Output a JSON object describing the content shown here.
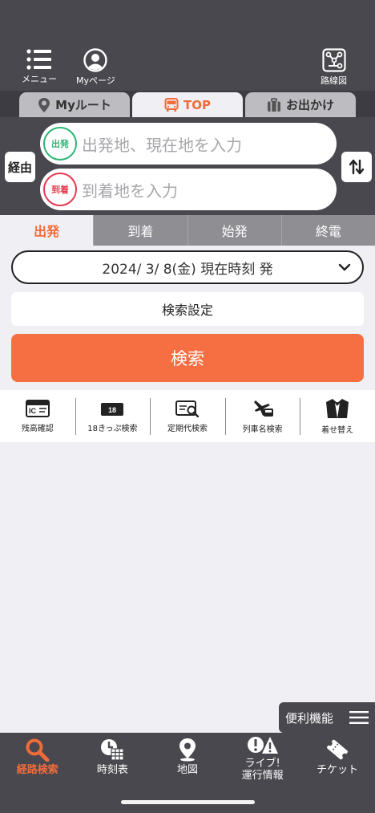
{
  "header": {
    "menu_label": "メニュー",
    "mypage_label": "Myページ",
    "routemap_label": "路線図"
  },
  "page_tabs": [
    {
      "label": "Myルート",
      "icon": "location-pin-icon"
    },
    {
      "label": "TOP",
      "icon": "bus-icon"
    },
    {
      "label": "お出かけ",
      "icon": "suitcase-icon"
    }
  ],
  "search_form": {
    "via_label": "経由",
    "departure_badge": "出発",
    "departure_placeholder": "出発地、現在地を入力",
    "arrival_badge": "到着",
    "arrival_placeholder": "到着地を入力",
    "departure_color": "#2bb673",
    "arrival_color": "#e8384f"
  },
  "time_tabs": [
    "出発",
    "到着",
    "始発",
    "終電"
  ],
  "date_selector": "2024/ 3/ 8(金) 現在時刻 発",
  "settings_label": "検索設定",
  "search_button_label": "検索",
  "features": [
    {
      "label": "残高確認",
      "icon": "ic-card-icon"
    },
    {
      "label": "18きっぷ検索",
      "icon": "ticket-18-icon"
    },
    {
      "label": "定期代検索",
      "icon": "commuter-pass-icon"
    },
    {
      "label": "列車名検索",
      "icon": "train-plane-icon"
    },
    {
      "label": "着せ替え",
      "icon": "tuxedo-icon"
    }
  ],
  "handy_menu_label": "便利機能",
  "bottom_nav": [
    {
      "label": "経路検索",
      "icon": "search-icon"
    },
    {
      "label": "時刻表",
      "icon": "timetable-icon"
    },
    {
      "label": "地図",
      "icon": "map-pin-icon"
    },
    {
      "label": "ライブ!\n運行情報",
      "icon": "alert-icon"
    },
    {
      "label": "チケット",
      "icon": "ticket-icon"
    }
  ],
  "colors": {
    "accent": "#f26b3a",
    "search_button": "#f56f42",
    "header_bg": "#48484e",
    "page_bg": "#efeff4"
  }
}
